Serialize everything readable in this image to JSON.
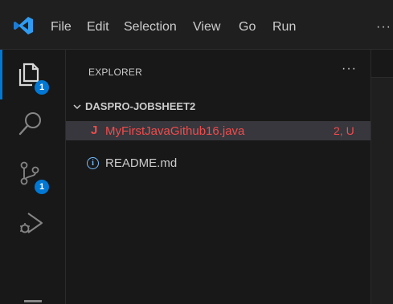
{
  "menubar": {
    "logo_icon": "vscode-logo-icon",
    "items": [
      "File",
      "Edit",
      "Selection",
      "View",
      "Go",
      "Run"
    ],
    "overflow": "···"
  },
  "activitybar": {
    "items": [
      {
        "icon": "files-icon",
        "badge": "1",
        "active": true
      },
      {
        "icon": "search-icon",
        "badge": null,
        "active": false
      },
      {
        "icon": "source-control-icon",
        "badge": "1",
        "active": false
      },
      {
        "icon": "run-debug-icon",
        "badge": null,
        "active": false
      }
    ]
  },
  "explorer": {
    "title": "EXPLORER",
    "more_label": "···",
    "folder": {
      "name": "DASPRO-JOBSHEET2",
      "expanded": true,
      "files": [
        {
          "icon_label": "J",
          "icon": "java-file-icon",
          "name": "MyFirstJavaGithub16.java",
          "status": "2, U",
          "selected": true,
          "color": "#f14c4c"
        },
        {
          "icon_label": "i",
          "icon": "info-icon",
          "name": "README.md",
          "status": "",
          "selected": false,
          "color": "#cccccc"
        }
      ]
    }
  },
  "colors": {
    "accent": "#0078d4",
    "error_modified": "#f14c4c",
    "info": "#75beff"
  }
}
